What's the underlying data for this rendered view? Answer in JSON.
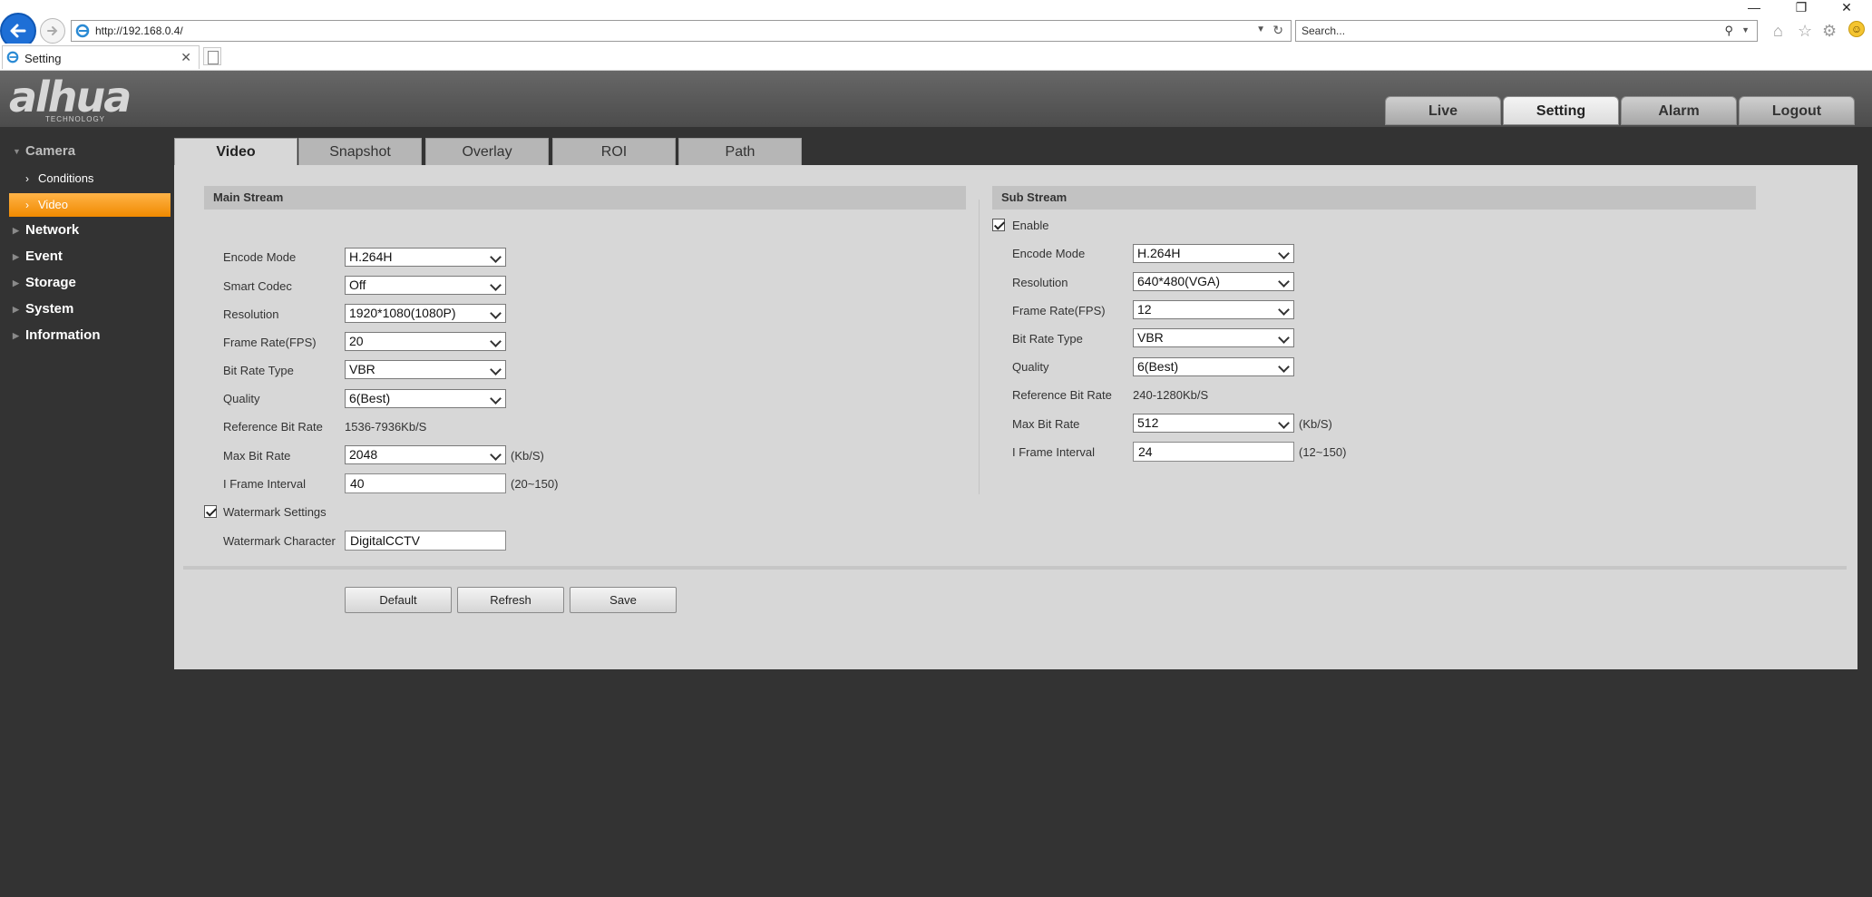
{
  "browser": {
    "url": "http://192.168.0.4/",
    "search_placeholder": "Search...",
    "tab_title": "Setting",
    "tab_close": "✕",
    "window_controls": [
      "—",
      "❐",
      "✕"
    ]
  },
  "logo": {
    "main": "alhua",
    "sub": "TECHNOLOGY"
  },
  "top_tabs": [
    "Live",
    "Setting",
    "Alarm",
    "Logout"
  ],
  "sidebar": {
    "groups": {
      "camera": "Camera",
      "network": "Network",
      "event": "Event",
      "storage": "Storage",
      "system": "System",
      "information": "Information"
    },
    "items": {
      "conditions": "Conditions",
      "video": "Video"
    }
  },
  "sub_tabs": [
    "Video",
    "Snapshot",
    "Overlay",
    "ROI",
    "Path"
  ],
  "main_stream": {
    "title": "Main Stream",
    "labels": {
      "encode_mode": "Encode Mode",
      "smart_codec": "Smart Codec",
      "resolution": "Resolution",
      "frame_rate": "Frame Rate(FPS)",
      "bit_rate_type": "Bit Rate Type",
      "quality": "Quality",
      "ref_bit_rate": "Reference Bit Rate",
      "max_bit_rate": "Max Bit Rate",
      "i_frame_interval": "I Frame Interval",
      "watermark_settings": "Watermark Settings",
      "watermark_character": "Watermark Character"
    },
    "values": {
      "encode_mode": "H.264H",
      "smart_codec": "Off",
      "resolution": "1920*1080(1080P)",
      "frame_rate": "20",
      "bit_rate_type": "VBR",
      "quality": "6(Best)",
      "ref_bit_rate": "1536-7936Kb/S",
      "max_bit_rate": "2048",
      "max_bit_rate_unit": "(Kb/S)",
      "i_frame_interval": "40",
      "i_frame_range": "(20~150)",
      "watermark_character": "DigitalCCTV"
    }
  },
  "sub_stream": {
    "title": "Sub Stream",
    "labels": {
      "enable": "Enable",
      "encode_mode": "Encode Mode",
      "resolution": "Resolution",
      "frame_rate": "Frame Rate(FPS)",
      "bit_rate_type": "Bit Rate Type",
      "quality": "Quality",
      "ref_bit_rate": "Reference Bit Rate",
      "max_bit_rate": "Max Bit Rate",
      "i_frame_interval": "I Frame Interval"
    },
    "values": {
      "encode_mode": "H.264H",
      "resolution": "640*480(VGA)",
      "frame_rate": "12",
      "bit_rate_type": "VBR",
      "quality": "6(Best)",
      "ref_bit_rate": "240-1280Kb/S",
      "max_bit_rate": "512",
      "max_bit_rate_unit": "(Kb/S)",
      "i_frame_interval": "24",
      "i_frame_range": "(12~150)"
    }
  },
  "buttons": {
    "default": "Default",
    "refresh": "Refresh",
    "save": "Save"
  },
  "colors": {
    "accent": "#f08a00",
    "background": "#333333",
    "panel": "#d7d7d7"
  }
}
